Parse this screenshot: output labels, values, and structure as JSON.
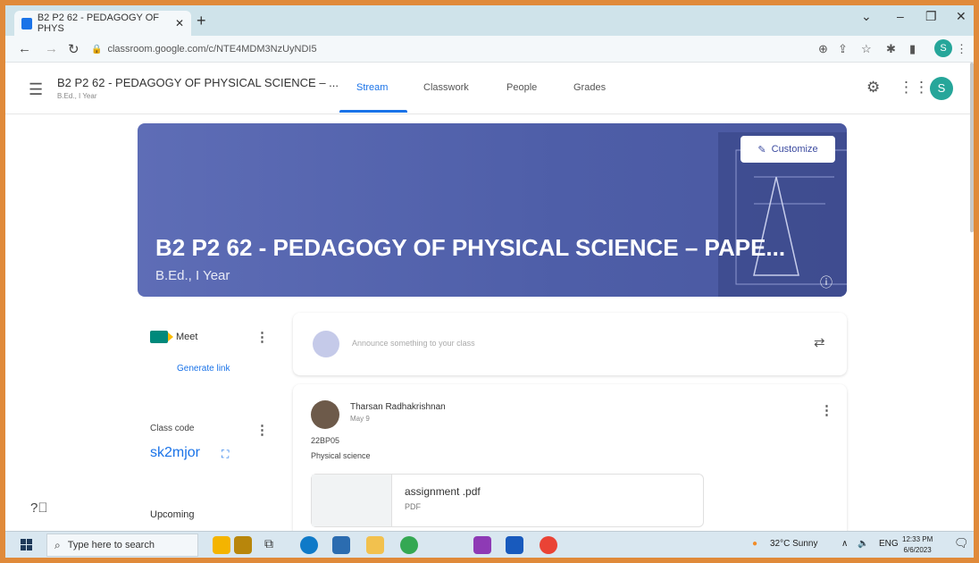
{
  "browser": {
    "tab_title": "B2 P2 62 - PEDAGOGY OF PHYS",
    "url": "classroom.google.com/c/NTE4MDM3NzUyNDI5",
    "profile_initial": "S"
  },
  "header": {
    "class_title": "B2 P2 62 - PEDAGOGY OF PHYSICAL SCIENCE – ...",
    "class_subtitle": "B.Ed., I Year",
    "tabs": [
      {
        "label": "Stream"
      },
      {
        "label": "Classwork"
      },
      {
        "label": "People"
      },
      {
        "label": "Grades"
      }
    ],
    "avatar_initial": "S"
  },
  "banner": {
    "title": "B2 P2 62 - PEDAGOGY OF PHYSICAL SCIENCE – PAPE...",
    "subtitle": "B.Ed., I Year",
    "customize_label": "Customize"
  },
  "meet": {
    "label": "Meet",
    "link_label": "Generate link"
  },
  "class_code": {
    "label": "Class code",
    "value": "sk2mjor"
  },
  "upcoming": {
    "label": "Upcoming"
  },
  "announce": {
    "placeholder": "Announce something to your class"
  },
  "post": {
    "author": "Tharsan Radhakrishnan",
    "date": "May 9",
    "line1": "22BP05",
    "line2": "Physical science",
    "attachment": {
      "name": "assignment .pdf",
      "type": "PDF"
    }
  },
  "taskbar": {
    "search_placeholder": "Type here to search",
    "weather": "32°C  Sunny",
    "language": "ENG",
    "time": "12:33 PM",
    "date": "6/6/2023"
  },
  "colors": {
    "accent": "#1a73e8",
    "banner": "#5262ab",
    "avatar": "#26a69a"
  }
}
